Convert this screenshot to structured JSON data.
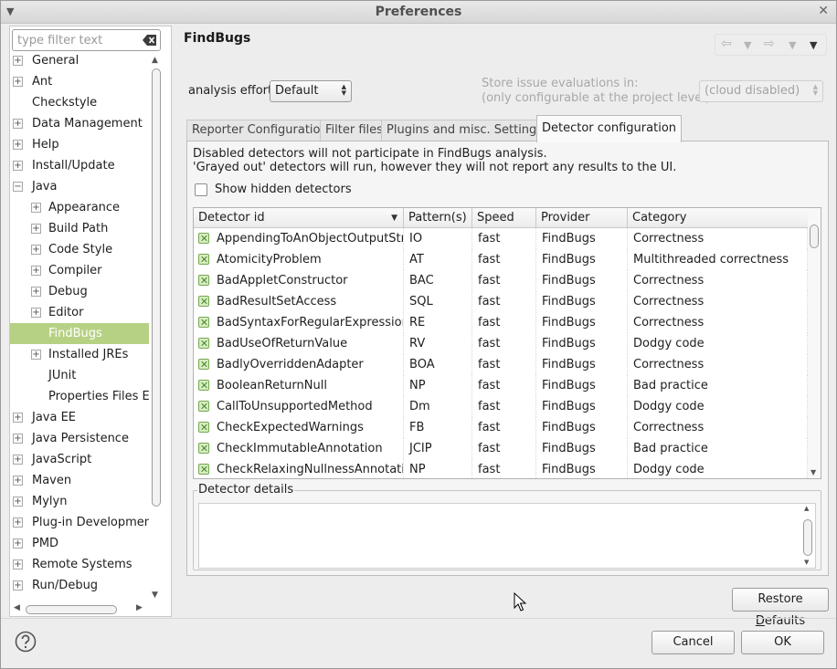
{
  "window": {
    "title": "Preferences"
  },
  "sidebar": {
    "filter_placeholder": "type filter text",
    "items": [
      {
        "label": "General",
        "expandable": true,
        "level": 0
      },
      {
        "label": "Ant",
        "expandable": true,
        "level": 0
      },
      {
        "label": "Checkstyle",
        "expandable": false,
        "level": 0
      },
      {
        "label": "Data Management",
        "expandable": true,
        "level": 0
      },
      {
        "label": "Help",
        "expandable": true,
        "level": 0
      },
      {
        "label": "Install/Update",
        "expandable": true,
        "level": 0
      },
      {
        "label": "Java",
        "expandable": true,
        "expanded": true,
        "level": 0
      },
      {
        "label": "Appearance",
        "expandable": true,
        "level": 1
      },
      {
        "label": "Build Path",
        "expandable": true,
        "level": 1
      },
      {
        "label": "Code Style",
        "expandable": true,
        "level": 1
      },
      {
        "label": "Compiler",
        "expandable": true,
        "level": 1
      },
      {
        "label": "Debug",
        "expandable": true,
        "level": 1
      },
      {
        "label": "Editor",
        "expandable": true,
        "level": 1
      },
      {
        "label": "FindBugs",
        "expandable": false,
        "level": 1,
        "selected": true
      },
      {
        "label": "Installed JREs",
        "expandable": true,
        "level": 1
      },
      {
        "label": "JUnit",
        "expandable": false,
        "level": 1
      },
      {
        "label": "Properties Files Ed",
        "expandable": false,
        "level": 1
      },
      {
        "label": "Java EE",
        "expandable": true,
        "level": 0
      },
      {
        "label": "Java Persistence",
        "expandable": true,
        "level": 0
      },
      {
        "label": "JavaScript",
        "expandable": true,
        "level": 0
      },
      {
        "label": "Maven",
        "expandable": true,
        "level": 0
      },
      {
        "label": "Mylyn",
        "expandable": true,
        "level": 0
      },
      {
        "label": "Plug-in Development",
        "expandable": true,
        "level": 0
      },
      {
        "label": "PMD",
        "expandable": true,
        "level": 0
      },
      {
        "label": "Remote Systems",
        "expandable": true,
        "level": 0
      },
      {
        "label": "Run/Debug",
        "expandable": true,
        "level": 0
      }
    ]
  },
  "main": {
    "title": "FindBugs",
    "analysis_effort": {
      "label": "analysis effort",
      "value": "Default"
    },
    "store": {
      "line1": "Store issue evaluations in:",
      "line2": "(only configurable at the project level)",
      "value": "(cloud disabled)"
    },
    "tabs": [
      {
        "label": "Reporter Configuration"
      },
      {
        "label": "Filter files"
      },
      {
        "label": "Plugins and misc. Settings"
      },
      {
        "label": "Detector configuration",
        "active": true
      }
    ],
    "detector": {
      "desc_line1": "Disabled detectors will not participate in FindBugs analysis.",
      "desc_line2": "'Grayed out' detectors will run, however they will not report any results to the UI.",
      "show_hidden_label": "Show hidden detectors",
      "columns": [
        "Detector id",
        "Pattern(s)",
        "Speed",
        "Provider",
        "Category"
      ],
      "rows": [
        [
          "AppendingToAnObjectOutputStream",
          "IO",
          "fast",
          "FindBugs",
          "Correctness"
        ],
        [
          "AtomicityProblem",
          "AT",
          "fast",
          "FindBugs",
          "Multithreaded correctness"
        ],
        [
          "BadAppletConstructor",
          "BAC",
          "fast",
          "FindBugs",
          "Correctness"
        ],
        [
          "BadResultSetAccess",
          "SQL",
          "fast",
          "FindBugs",
          "Correctness"
        ],
        [
          "BadSyntaxForRegularExpression",
          "RE",
          "fast",
          "FindBugs",
          "Correctness"
        ],
        [
          "BadUseOfReturnValue",
          "RV",
          "fast",
          "FindBugs",
          "Dodgy code"
        ],
        [
          "BadlyOverriddenAdapter",
          "BOA",
          "fast",
          "FindBugs",
          "Correctness"
        ],
        [
          "BooleanReturnNull",
          "NP",
          "fast",
          "FindBugs",
          "Bad practice"
        ],
        [
          "CallToUnsupportedMethod",
          "Dm",
          "fast",
          "FindBugs",
          "Dodgy code"
        ],
        [
          "CheckExpectedWarnings",
          "FB",
          "fast",
          "FindBugs",
          "Correctness"
        ],
        [
          "CheckImmutableAnnotation",
          "JCIP",
          "fast",
          "FindBugs",
          "Bad practice"
        ],
        [
          "CheckRelaxingNullnessAnnotation",
          "NP",
          "fast",
          "FindBugs",
          "Dodgy code"
        ]
      ],
      "details_label": "Detector details"
    }
  },
  "buttons": {
    "restore_prefix": "Restore ",
    "restore_mnemonic": "D",
    "restore_suffix": "efaults",
    "cancel": "Cancel",
    "ok": "OK"
  },
  "icons": {
    "close": "close-icon",
    "window_menu": "chevron-down-icon",
    "back": "back-arrow-icon",
    "forward": "forward-arrow-icon",
    "help": "help-icon",
    "clear": "clear-icon"
  },
  "colors": {
    "selection": "#b7d184",
    "enabled_check": "#77a851"
  }
}
